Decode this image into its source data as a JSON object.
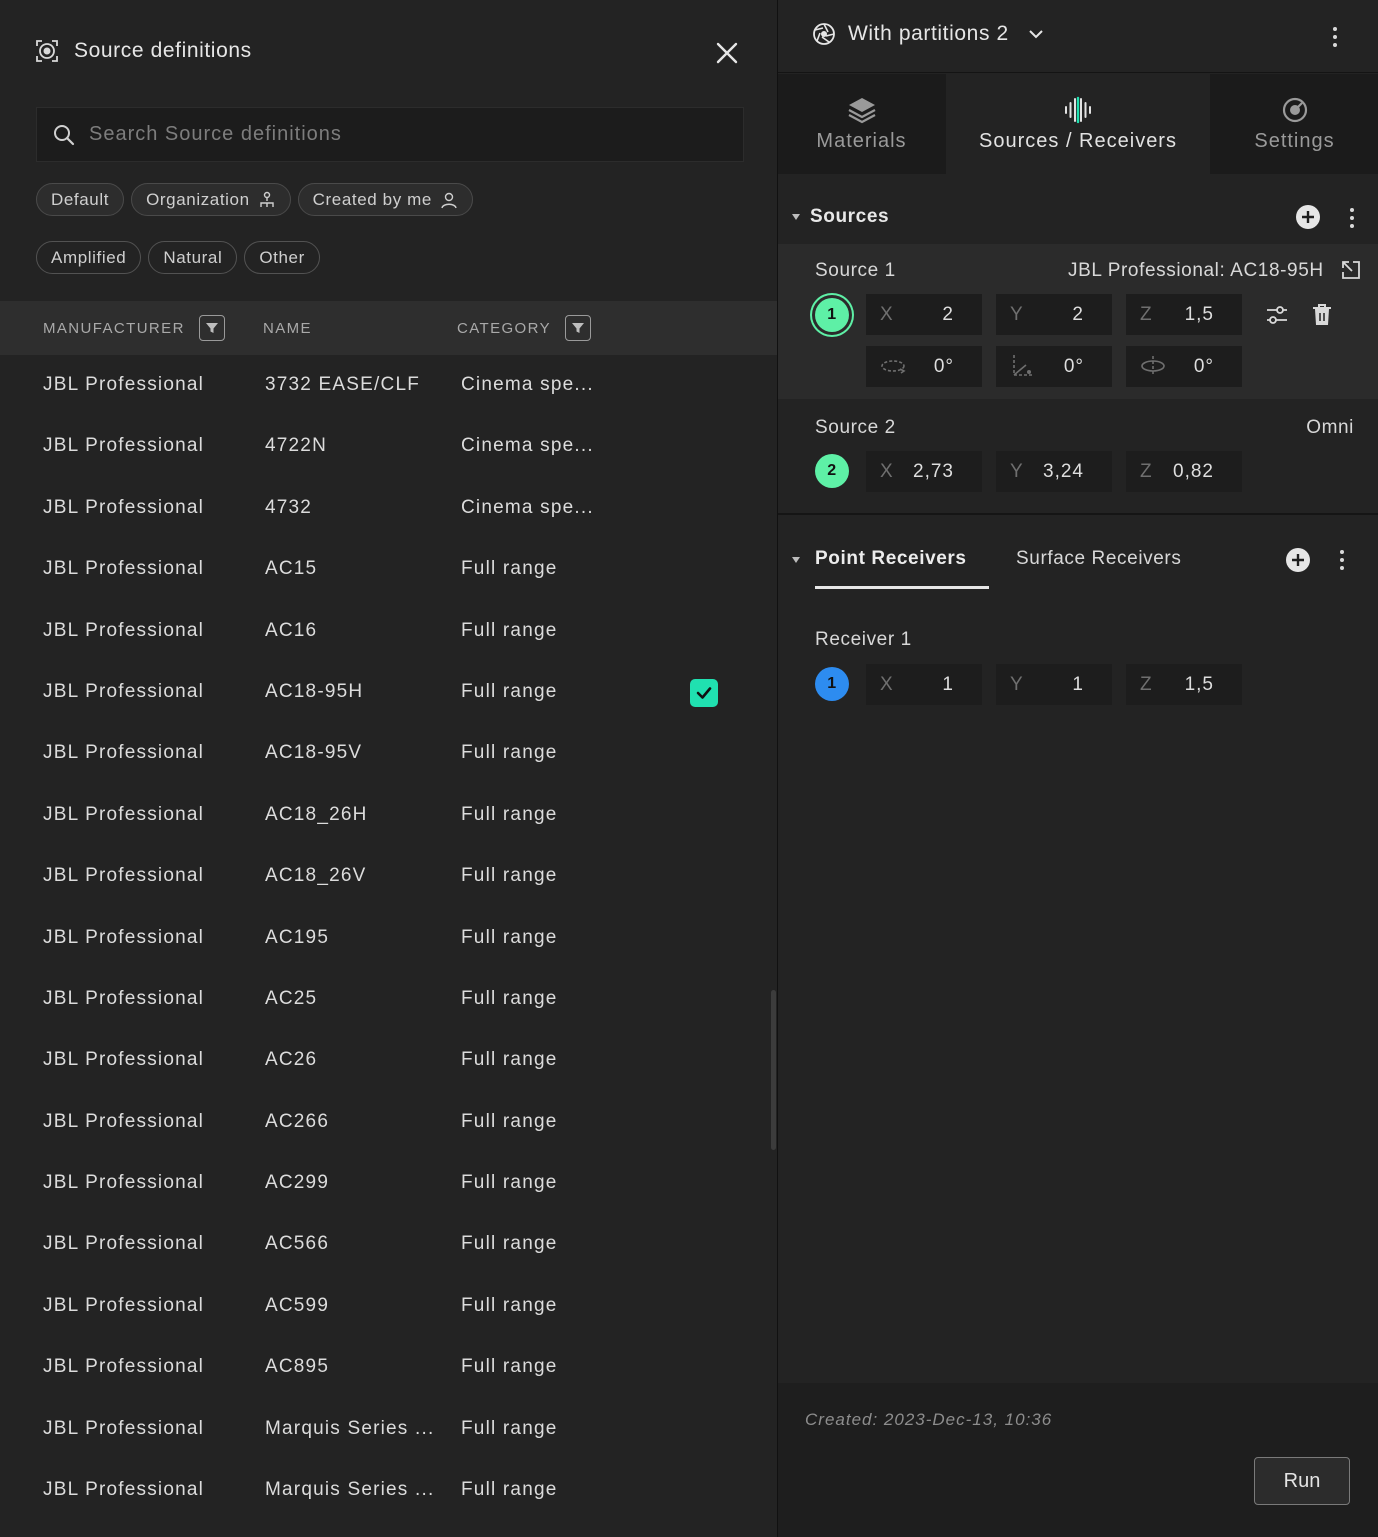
{
  "source_defs": {
    "title": "Source definitions",
    "search_placeholder": "Search Source definitions",
    "filters_row1": [
      "Default",
      "Organization",
      "Created by me"
    ],
    "filters_row2": [
      "Amplified",
      "Natural",
      "Other"
    ],
    "columns": {
      "manufacturer": "MANUFACTURER",
      "name": "NAME",
      "category": "CATEGORY"
    },
    "rows": [
      {
        "manufacturer": "JBL Professional",
        "name": "3732 EASE/CLF",
        "category": "Cinema spe..."
      },
      {
        "manufacturer": "JBL Professional",
        "name": "4722N",
        "category": "Cinema spe..."
      },
      {
        "manufacturer": "JBL Professional",
        "name": "4732",
        "category": "Cinema spe..."
      },
      {
        "manufacturer": "JBL Professional",
        "name": "AC15",
        "category": "Full range"
      },
      {
        "manufacturer": "JBL Professional",
        "name": "AC16",
        "category": "Full range"
      },
      {
        "manufacturer": "JBL Professional",
        "name": "AC18-95H",
        "category": "Full range",
        "selected": true
      },
      {
        "manufacturer": "JBL Professional",
        "name": "AC18-95V",
        "category": "Full range"
      },
      {
        "manufacturer": "JBL Professional",
        "name": "AC18_26H",
        "category": "Full range"
      },
      {
        "manufacturer": "JBL Professional",
        "name": "AC18_26V",
        "category": "Full range"
      },
      {
        "manufacturer": "JBL Professional",
        "name": "AC195",
        "category": "Full range"
      },
      {
        "manufacturer": "JBL Professional",
        "name": "AC25",
        "category": "Full range"
      },
      {
        "manufacturer": "JBL Professional",
        "name": "AC26",
        "category": "Full range"
      },
      {
        "manufacturer": "JBL Professional",
        "name": "AC266",
        "category": "Full range"
      },
      {
        "manufacturer": "JBL Professional",
        "name": "AC299",
        "category": "Full range"
      },
      {
        "manufacturer": "JBL Professional",
        "name": "AC566",
        "category": "Full range"
      },
      {
        "manufacturer": "JBL Professional",
        "name": "AC599",
        "category": "Full range"
      },
      {
        "manufacturer": "JBL Professional",
        "name": "AC895",
        "category": "Full range"
      },
      {
        "manufacturer": "JBL Professional",
        "name": "Marquis Series ...",
        "category": "Full range"
      },
      {
        "manufacturer": "JBL Professional",
        "name": "Marquis Series ...",
        "category": "Full range"
      }
    ]
  },
  "project": {
    "name": "With partitions 2"
  },
  "tabs": {
    "materials": "Materials",
    "sources_receivers": "Sources / Receivers",
    "settings": "Settings"
  },
  "sources": {
    "header": "Sources",
    "items": [
      {
        "label": "Source 1",
        "number": "1",
        "definition": "JBL Professional: AC18-95H",
        "x": "2",
        "y": "2",
        "z": "1,5",
        "azimuth": "0°",
        "elevation": "0°",
        "rotation": "0°",
        "color": "#5ef0a6"
      },
      {
        "label": "Source 2",
        "number": "2",
        "definition": "Omni",
        "x": "2,73",
        "y": "3,24",
        "z": "0,82",
        "color": "#5ef0a6"
      }
    ]
  },
  "receivers": {
    "tab_point": "Point Receivers",
    "tab_surface": "Surface Receivers",
    "items": [
      {
        "label": "Receiver 1",
        "number": "1",
        "x": "1",
        "y": "1",
        "z": "1,5",
        "color": "#2d8cf0"
      }
    ]
  },
  "axes": {
    "x": "X",
    "y": "Y",
    "z": "Z"
  },
  "footer": {
    "created": "Created: 2023-Dec-13, 10:36",
    "run_label": "Run"
  },
  "colors": {
    "accent_green": "#20e0b0",
    "source_badge": "#5ef0a6",
    "receiver_badge": "#2d8cf0"
  }
}
